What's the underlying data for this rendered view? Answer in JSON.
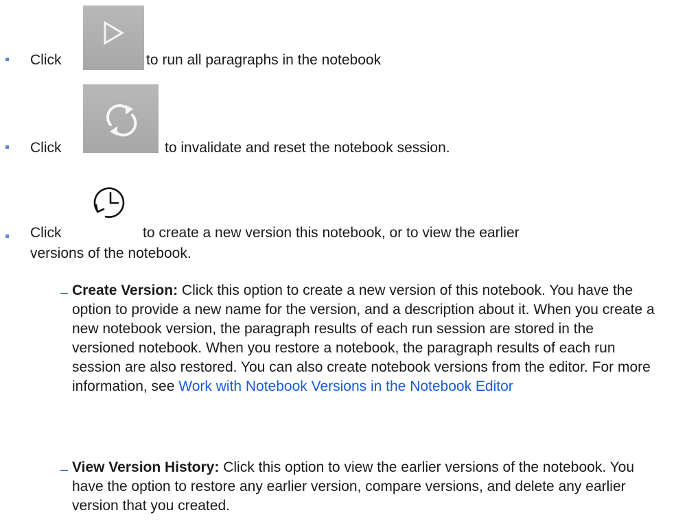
{
  "items": [
    {
      "click": "Click",
      "icon": "play-icon",
      "text": "to run all paragraphs in the notebook"
    },
    {
      "click": "Click",
      "icon": "refresh-icon",
      "text": "to invalidate and reset the notebook session."
    },
    {
      "click": "Click",
      "icon": "history-icon",
      "text_line1": "to create a new version this notebook, or to view the earlier",
      "text_line2": "versions of the notebook."
    }
  ],
  "subitems": [
    {
      "term": "Create Version:",
      "body_before_link": " Click this option to create a new version of this notebook. You have the option to provide a new name for the version, and a description about it. When you create a new notebook version, the paragraph results of each run session are stored in the versioned notebook. When you restore a notebook, the paragraph results of each run session are also restored. You can also create notebook versions from the editor. For more information, see ",
      "link": "Work with Notebook Versions in the Notebook Editor"
    },
    {
      "term": "View Version History:",
      "body": " Click this option to view the earlier versions of the notebook. You have the option to restore any earlier version, compare versions, and delete any earlier version that you created."
    }
  ],
  "colors": {
    "bullet": "#5b8ad0",
    "link": "#1a5ad8",
    "icon_bg": "#b0b0b0"
  }
}
